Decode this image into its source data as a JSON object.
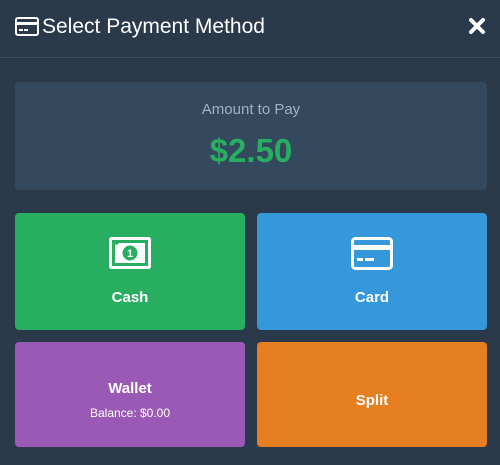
{
  "header": {
    "title": "Select Payment Method",
    "title_icon": "credit-card-icon",
    "close_icon": "close-icon"
  },
  "amount": {
    "label": "Amount to Pay",
    "value": "$2.50"
  },
  "methods": {
    "cash": {
      "label": "Cash",
      "icon": "money-bill-icon",
      "color": "#27ae60"
    },
    "card": {
      "label": "Card",
      "icon": "credit-card-icon",
      "color": "#3498db"
    },
    "wallet": {
      "label": "Wallet",
      "balance": "Balance: $0.00",
      "color": "#9b59b6"
    },
    "split": {
      "label": "Split",
      "color": "#e67e22"
    }
  },
  "colors": {
    "background": "#2b3a4b",
    "panel": "#34495e",
    "amount_value": "#27ae60"
  }
}
